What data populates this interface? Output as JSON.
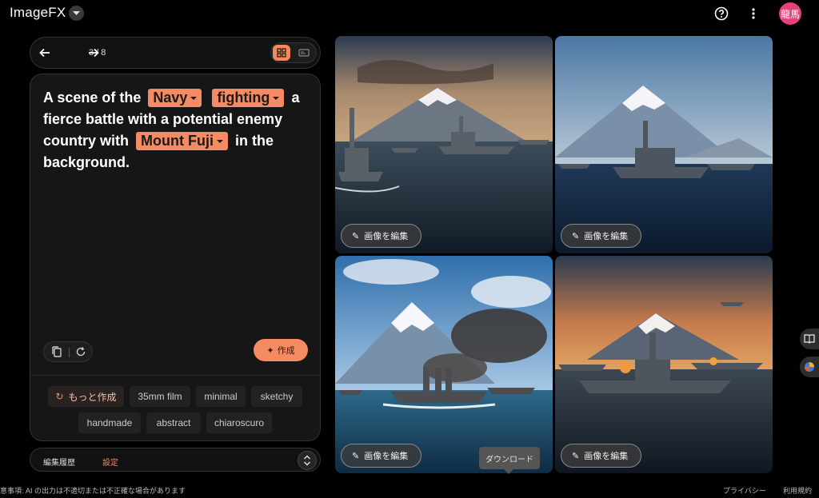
{
  "app": {
    "title": "ImageFX",
    "avatar_text": "龍馬"
  },
  "pager": {
    "count": "3 / 8"
  },
  "prompt": {
    "segments": [
      {
        "type": "text",
        "value": "A scene of the"
      },
      {
        "type": "chip",
        "value": "Navy"
      },
      {
        "type": "chip",
        "value": "fighting"
      },
      {
        "type": "text",
        "value": "a fierce battle with a potential enemy country with"
      },
      {
        "type": "chip",
        "value": "Mount Fuji"
      },
      {
        "type": "text",
        "value": "in the background."
      }
    ],
    "create_label": "作成"
  },
  "more": {
    "more_create_label": "もっと作成",
    "tags": [
      "35mm film",
      "minimal",
      "sketchy",
      "handmade",
      "abstract",
      "chiaroscuro"
    ]
  },
  "tabs": {
    "history": "編集履歴",
    "settings": "設定"
  },
  "images": [
    {
      "edit_label": "画像を編集"
    },
    {
      "edit_label": "画像を編集"
    },
    {
      "edit_label": "画像を編集"
    },
    {
      "edit_label": "画像を編集"
    }
  ],
  "tooltip": {
    "download": "ダウンロード"
  },
  "footer": {
    "notice": "意事項: AI の出力は不適切または不正確な場合があります",
    "privacy": "プライバシー",
    "terms": "利用規約"
  },
  "colors": {
    "accent": "#f48b63",
    "avatar": "#e8407a"
  }
}
